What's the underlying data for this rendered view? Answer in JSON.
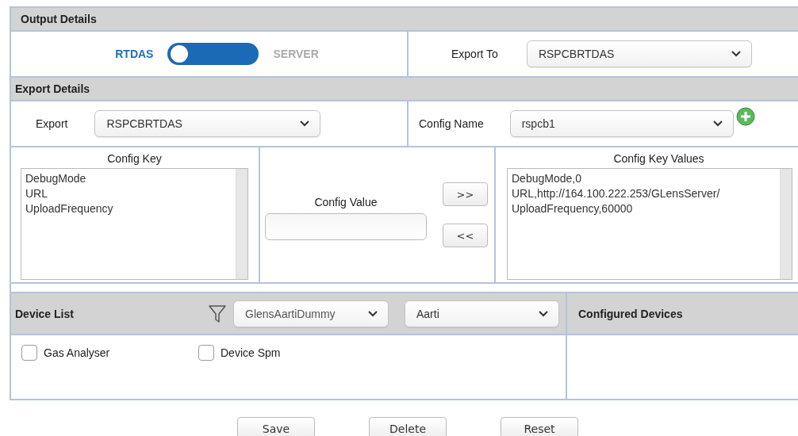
{
  "output_details": {
    "title": "Output Details",
    "toggle": {
      "left_label": "RTDAS",
      "right_label": "SERVER",
      "server_selected": false
    },
    "export_to": {
      "label": "Export To",
      "value": "RSPCBRTDAS"
    }
  },
  "export_details": {
    "title": "Export Details",
    "export": {
      "label": "Export",
      "value": "RSPCBRTDAS"
    },
    "config_name": {
      "label": "Config Name",
      "value": "rspcb1"
    }
  },
  "config_key": {
    "title": "Config Key",
    "items": [
      "DebugMode",
      "URL",
      "UploadFrequency"
    ]
  },
  "config_value": {
    "label": "Config Value"
  },
  "transfer_buttons": [
    ">>",
    "<<"
  ],
  "config_key_values": {
    "title": "Config Key Values",
    "items": [
      "DebugMode,0",
      "URL,http://164.100.222.253/GLensServer/",
      "UploadFrequency,60000"
    ]
  },
  "device_list": {
    "title": "Device List",
    "filters": [
      "GlensAartiDummy",
      "Aarti"
    ],
    "devices": [
      {
        "label": "Gas Analyser",
        "checked": false
      },
      {
        "label": "Device Spm",
        "checked": false
      }
    ]
  },
  "configured_devices": {
    "title": "Configured Devices"
  },
  "buttons": [
    "Save",
    "Delete",
    "Reset"
  ]
}
